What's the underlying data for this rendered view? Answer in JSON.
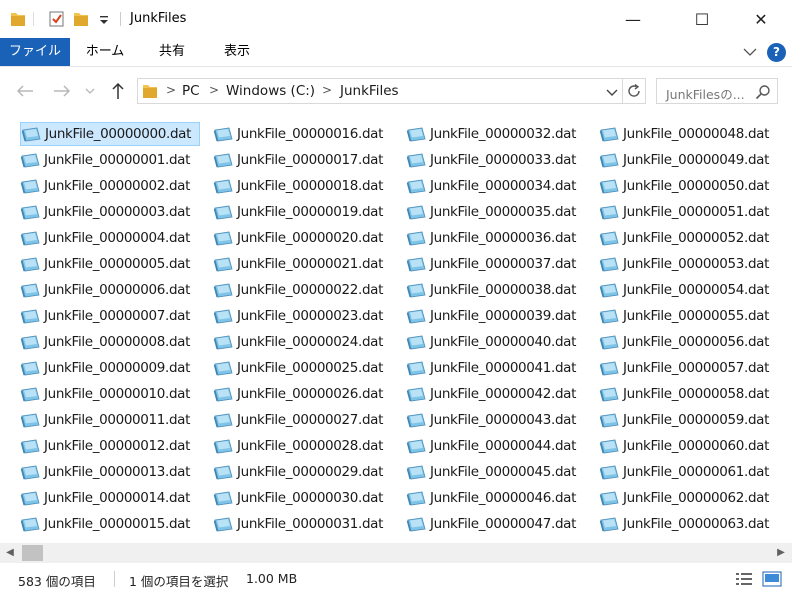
{
  "window": {
    "title": "JunkFiles",
    "minimize_glyph": "—",
    "maximize_glyph": "☐",
    "close_glyph": "✕"
  },
  "ribbon": {
    "tabs": [
      "ファイル",
      "ホーム",
      "共有",
      "表示"
    ],
    "help_label": "?"
  },
  "address": {
    "segments": [
      "PC",
      "Windows (C:)",
      "JunkFiles"
    ],
    "search_placeholder": "JunkFilesの..."
  },
  "files": {
    "selected_index": 0,
    "names": [
      "JunkFile_00000000.dat",
      "JunkFile_00000001.dat",
      "JunkFile_00000002.dat",
      "JunkFile_00000003.dat",
      "JunkFile_00000004.dat",
      "JunkFile_00000005.dat",
      "JunkFile_00000006.dat",
      "JunkFile_00000007.dat",
      "JunkFile_00000008.dat",
      "JunkFile_00000009.dat",
      "JunkFile_00000010.dat",
      "JunkFile_00000011.dat",
      "JunkFile_00000012.dat",
      "JunkFile_00000013.dat",
      "JunkFile_00000014.dat",
      "JunkFile_00000015.dat",
      "JunkFile_00000016.dat",
      "JunkFile_00000017.dat",
      "JunkFile_00000018.dat",
      "JunkFile_00000019.dat",
      "JunkFile_00000020.dat",
      "JunkFile_00000021.dat",
      "JunkFile_00000022.dat",
      "JunkFile_00000023.dat",
      "JunkFile_00000024.dat",
      "JunkFile_00000025.dat",
      "JunkFile_00000026.dat",
      "JunkFile_00000027.dat",
      "JunkFile_00000028.dat",
      "JunkFile_00000029.dat",
      "JunkFile_00000030.dat",
      "JunkFile_00000031.dat",
      "JunkFile_00000032.dat",
      "JunkFile_00000033.dat",
      "JunkFile_00000034.dat",
      "JunkFile_00000035.dat",
      "JunkFile_00000036.dat",
      "JunkFile_00000037.dat",
      "JunkFile_00000038.dat",
      "JunkFile_00000039.dat",
      "JunkFile_00000040.dat",
      "JunkFile_00000041.dat",
      "JunkFile_00000042.dat",
      "JunkFile_00000043.dat",
      "JunkFile_00000044.dat",
      "JunkFile_00000045.dat",
      "JunkFile_00000046.dat",
      "JunkFile_00000047.dat",
      "JunkFile_00000048.dat",
      "JunkFile_00000049.dat",
      "JunkFile_00000050.dat",
      "JunkFile_00000051.dat",
      "JunkFile_00000052.dat",
      "JunkFile_00000053.dat",
      "JunkFile_00000054.dat",
      "JunkFile_00000055.dat",
      "JunkFile_00000056.dat",
      "JunkFile_00000057.dat",
      "JunkFile_00000058.dat",
      "JunkFile_00000059.dat",
      "JunkFile_00000060.dat",
      "JunkFile_00000061.dat",
      "JunkFile_00000062.dat",
      "JunkFile_00000063.dat"
    ]
  },
  "status": {
    "item_count": "583 個の項目",
    "selection": "1 個の項目を選択",
    "size": "1.00 MB"
  },
  "icons": {
    "folder": "folder-icon",
    "properties": "properties-icon",
    "new_folder": "new-folder-icon",
    "quick_access_dropdown": "chevron-down-icon",
    "back": "back-arrow-icon",
    "forward": "forward-arrow-icon",
    "recent": "chevron-down-icon",
    "up": "up-arrow-icon",
    "refresh": "refresh-icon",
    "search": "search-icon",
    "file": "dat-file-icon",
    "details_view": "details-view-icon",
    "large_icons_view": "large-icons-view-icon"
  },
  "colors": {
    "accent": "#1a62b8",
    "selection_bg": "#cce8ff",
    "selection_border": "#99d1ff",
    "folder": "#f2c44f"
  }
}
